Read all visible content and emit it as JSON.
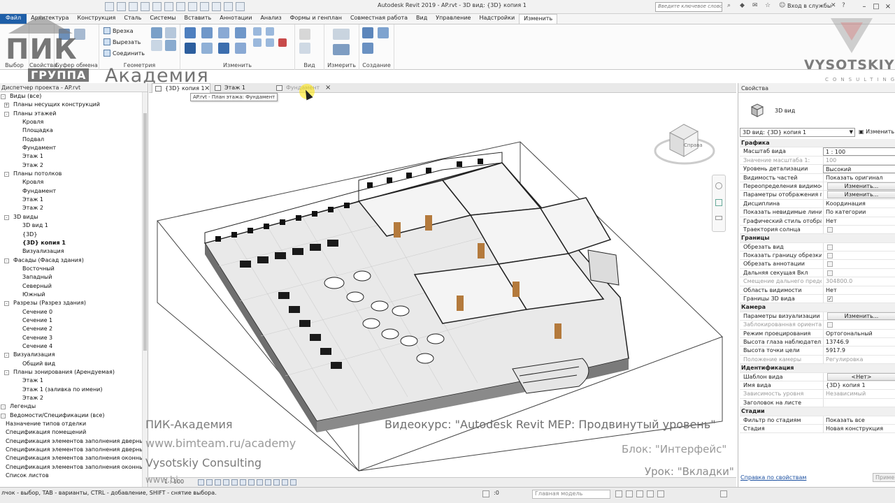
{
  "window": {
    "title": "Autodesk Revit 2019 - AP.rvt - 3D вид: {3D} копия 1",
    "search_placeholder": "Введите ключевое слово/фразу",
    "login_label": "Вход в службы"
  },
  "ribbon": {
    "tabs": [
      "Файл",
      "Архитектура",
      "Конструкция",
      "Сталь",
      "Системы",
      "Вставить",
      "Аннотации",
      "Анализ",
      "Формы и генплан",
      "Совместная работа",
      "Вид",
      "Управление",
      "Надстройки",
      "Изменить"
    ],
    "active_tab": "Изменить",
    "panels": {
      "clipboard": "Буфер обмена",
      "properties": "Свойства",
      "select": "Выбор",
      "geometry": "Геометрия",
      "modify": "Изменить",
      "view": "Вид",
      "measure": "Измерить",
      "create": "Создание"
    },
    "geometry_items": [
      "Врезка",
      "Вырезать",
      "Соединить"
    ]
  },
  "watermark": {
    "pik": "ПИК",
    "gruppa": "ГРУППА",
    "academy": "Академия",
    "vysotskiy": "VYSOTSKIY",
    "consulting": "CONSULTING"
  },
  "browser": {
    "title": "Диспетчер проекта - AP.rvt",
    "nodes": [
      {
        "label": "Виды (все)",
        "level": 0,
        "toggle": "-"
      },
      {
        "label": "Планы несущих конструкций",
        "level": 1,
        "toggle": "+"
      },
      {
        "label": "Планы этажей",
        "level": 1,
        "toggle": "-"
      },
      {
        "label": "Кровля",
        "level": 2
      },
      {
        "label": "Площадка",
        "level": 2
      },
      {
        "label": "Подвал",
        "level": 2
      },
      {
        "label": "Фундамент",
        "level": 2
      },
      {
        "label": "Этаж 1",
        "level": 2
      },
      {
        "label": "Этаж 2",
        "level": 2
      },
      {
        "label": "Планы потолков",
        "level": 1,
        "toggle": "-"
      },
      {
        "label": "Кровля",
        "level": 2
      },
      {
        "label": "Фундамент",
        "level": 2
      },
      {
        "label": "Этаж 1",
        "level": 2
      },
      {
        "label": "Этаж 2",
        "level": 2
      },
      {
        "label": "3D виды",
        "level": 1,
        "toggle": "-"
      },
      {
        "label": "3D вид 1",
        "level": 2
      },
      {
        "label": "{3D}",
        "level": 2
      },
      {
        "label": "{3D} копия 1",
        "level": 2,
        "bold": true
      },
      {
        "label": "Визуализация",
        "level": 2
      },
      {
        "label": "Фасады (Фасад здания)",
        "level": 1,
        "toggle": "-"
      },
      {
        "label": "Восточный",
        "level": 2
      },
      {
        "label": "Западный",
        "level": 2
      },
      {
        "label": "Северный",
        "level": 2
      },
      {
        "label": "Южный",
        "level": 2
      },
      {
        "label": "Разрезы (Разрез здания)",
        "level": 1,
        "toggle": "-"
      },
      {
        "label": "Сечение 0",
        "level": 2
      },
      {
        "label": "Сечение 1",
        "level": 2
      },
      {
        "label": "Сечение 2",
        "level": 2
      },
      {
        "label": "Сечение 3",
        "level": 2
      },
      {
        "label": "Сечение 4",
        "level": 2
      },
      {
        "label": "Визуализация",
        "level": 1,
        "toggle": "-"
      },
      {
        "label": "Общий вид",
        "level": 2
      },
      {
        "label": "Планы зонирования (Арендуемая)",
        "level": 1,
        "toggle": "-"
      },
      {
        "label": "Этаж 1",
        "level": 2
      },
      {
        "label": "Этаж 1 (заливка по имени)",
        "level": 2
      },
      {
        "label": "Этаж 2",
        "level": 2
      },
      {
        "label": "Легенды",
        "level": 0,
        "toggle": "-"
      },
      {
        "label": "Ведомости/Спецификации (все)",
        "level": 0,
        "toggle": "-"
      },
      {
        "label": "Назначение типов отделки",
        "level": 1
      },
      {
        "label": "Спецификация помещений",
        "level": 1
      },
      {
        "label": "Спецификация элементов заполнения дверных п",
        "level": 1
      },
      {
        "label": "Спецификация элементов заполнения дверных п",
        "level": 1
      },
      {
        "label": "Спецификация элементов заполнения оконных п",
        "level": 1
      },
      {
        "label": "Спецификация элементов заполнения оконных п",
        "level": 1
      },
      {
        "label": "Список листов",
        "level": 1
      }
    ]
  },
  "view_tabs": [
    {
      "label": "{3D} копия 1",
      "active": true
    },
    {
      "label": "Этаж 1"
    },
    {
      "label": "Фундамент"
    }
  ],
  "tooltip": "AP.rvt - План этажа: Фундамент",
  "viewcube_face": "Справа",
  "view_scale": "1 : 100",
  "overlay": {
    "pik_academy": "ПИК-Академия",
    "url": "www.bimteam.ru/academy",
    "vysotskiy": "Vysotskiy Consulting",
    "url_short": "www.bi",
    "course": "Видеокурс: \"Autodesk Revit MEP: Продвинутый уровень\"",
    "block": "Блок: \"Интерфейс\"",
    "lesson": "Урок: \"Вкладки\""
  },
  "properties": {
    "title": "Свойства",
    "type_name": "3D вид",
    "selector": "3D вид: {3D} копия 1",
    "edit_type": "Изменить",
    "rows": [
      {
        "group": "Графика"
      },
      {
        "k": "Масштаб вида",
        "v": "1 : 100",
        "boxed": true
      },
      {
        "k": "Значение масштаба    1:",
        "v": "100",
        "dim": true
      },
      {
        "k": "Уровень детализации",
        "v": "Высокий",
        "boxed": true
      },
      {
        "k": "Видимость частей",
        "v": "Показать оригинал"
      },
      {
        "k": "Переопределения видимос...",
        "btn": "Изменить..."
      },
      {
        "k": "Параметры отображения г...",
        "btn": "Изменить..."
      },
      {
        "k": "Дисциплина",
        "v": "Координация"
      },
      {
        "k": "Показать невидимые линии",
        "v": "По категории"
      },
      {
        "k": "Графический стиль отобра...",
        "v": "Нет"
      },
      {
        "k": "Траектория солнца",
        "cb": false
      },
      {
        "group": "Границы"
      },
      {
        "k": "Обрезать вид",
        "cb": false
      },
      {
        "k": "Показать границу обрезки",
        "cb": false
      },
      {
        "k": "Обрезать аннотации",
        "cb": false
      },
      {
        "k": "Дальняя секущая Вкл",
        "cb": false
      },
      {
        "k": "Смещение дальнего преде...",
        "v": "304800.0",
        "dim": true
      },
      {
        "k": "Область видимости",
        "v": "Нет"
      },
      {
        "k": "Границы 3D вида",
        "cb": true
      },
      {
        "group": "Камера"
      },
      {
        "k": "Параметры визуализации",
        "btn": "Изменить..."
      },
      {
        "k": "Заблокированная ориентац...",
        "cb": false,
        "dim": true
      },
      {
        "k": "Режим проецирования",
        "v": "Ортогональный"
      },
      {
        "k": "Высота глаза наблюдателя",
        "v": "13746.9"
      },
      {
        "k": "Высота точки цели",
        "v": "5917.9"
      },
      {
        "k": "Положение камеры",
        "v": "Регулировка",
        "dim": true
      },
      {
        "group": "Идентификация"
      },
      {
        "k": "Шаблон вида",
        "btn": "<Нет>"
      },
      {
        "k": "Имя вида",
        "v": "{3D} копия 1"
      },
      {
        "k": "Зависимость уровня",
        "v": "Независимый",
        "dim": true
      },
      {
        "k": "Заголовок на листе",
        "v": ""
      },
      {
        "group": "Стадии"
      },
      {
        "k": "Фильтр по стадиям",
        "v": "Показать все"
      },
      {
        "k": "Стадия",
        "v": "Новая конструкция"
      }
    ],
    "help_link": "Справка по свойствам",
    "apply": "Приме"
  },
  "statusbar": {
    "message": "лчок - выбор, TAB - варианты, CTRL - добавление, SHIFT - снятие выбора.",
    "zero": ":0",
    "model": "Главная модель"
  }
}
